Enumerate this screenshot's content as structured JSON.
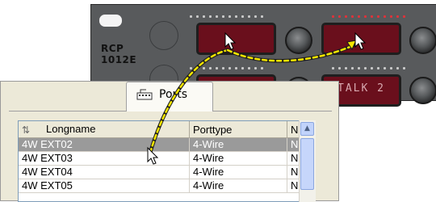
{
  "panel": {
    "model_line1": "RCP",
    "model_line2": "1012E",
    "keys": [
      {
        "label": ""
      },
      {
        "label": ""
      },
      {
        "label": ""
      },
      {
        "label": "TALK 2"
      }
    ],
    "led_colors": {
      "idle": "#c9c9c9",
      "active": "#e0323a"
    }
  },
  "dialog": {
    "tab_label": "Ports",
    "tab_icon": "ports-icon",
    "table": {
      "columns": [
        "Longname",
        "Porttype",
        "N"
      ],
      "rows": [
        {
          "name": "4W EXT02",
          "type": "4-Wire",
          "n": "N",
          "selected": true
        },
        {
          "name": "4W EXT03",
          "type": "4-Wire",
          "n": "N",
          "selected": false
        },
        {
          "name": "4W EXT04",
          "type": "4-Wire",
          "n": "N",
          "selected": false
        },
        {
          "name": "4W EXT05",
          "type": "4-Wire",
          "n": "N",
          "selected": false
        }
      ]
    }
  },
  "colors": {
    "drag_path": "#f5e600",
    "panel_bg": "#585a5c",
    "key_bg": "#6a0f1c",
    "selection": "#9a9a9a"
  }
}
